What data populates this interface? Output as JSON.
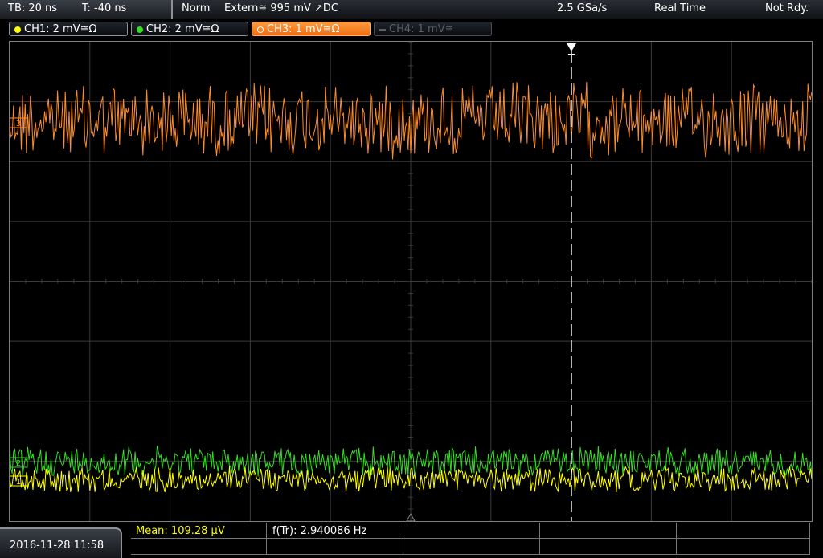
{
  "colors": {
    "ch1": "#ffff00",
    "ch2": "#33dd22",
    "ch3": "#ff8c2a",
    "ch4": "#5c5f63",
    "grid": "#3a3a3a",
    "trigger_marker": "#ffffff"
  },
  "topbar": {
    "timebase": "TB: 20 ns",
    "trigger_offset": "T: -40 ns",
    "acq_mode": "Norm",
    "trigger_source": "Extern≅ 995 mV ↗DC",
    "sample_rate": "2.5 GSa/s",
    "sampling_mode": "Real Time",
    "status": "Not Rdy."
  },
  "channels": [
    {
      "label": "CH1: 2 mV≅Ω",
      "dot_icon": "yellow-dot-icon"
    },
    {
      "label": "CH2: 2 mV≅Ω",
      "dot_icon": "green-dot-icon"
    },
    {
      "label": "CH3: 1 mV≅Ω",
      "dot_icon": "orange-dot-icon"
    },
    {
      "label": "CH4: 1 mV≅",
      "dot_icon": "gray-dash-icon"
    }
  ],
  "plot": {
    "trigger_marker_label": "T",
    "ch3_marker": "3",
    "ch2_marker": "2",
    "ch1_marker": "1"
  },
  "bottombar": {
    "datetime": "2016-11-28 11:58",
    "mean_label": "Mean: 109.28 µV",
    "freq_label": "f(Tr): 2.940086 Hz"
  }
}
